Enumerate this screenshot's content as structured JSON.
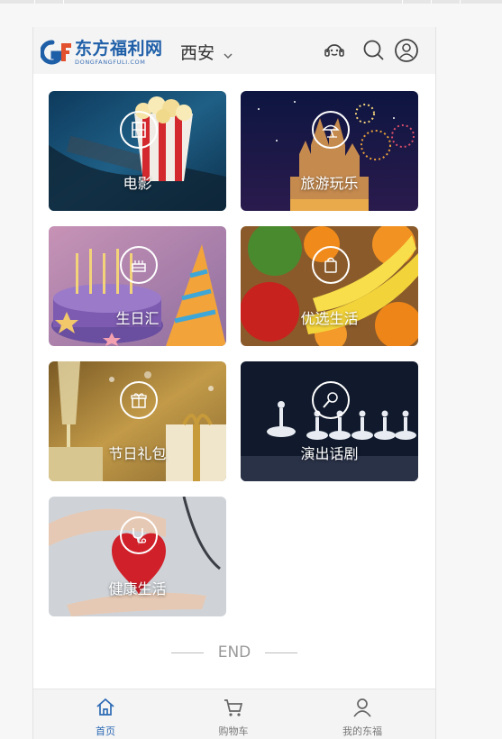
{
  "header": {
    "logo_text": "东方福利网",
    "logo_subtext": "DONGFANGFULI.COM",
    "city": "西安"
  },
  "categories": [
    {
      "label": "电影",
      "icon": "film-icon"
    },
    {
      "label": "旅游玩乐",
      "icon": "beach-umbrella-icon"
    },
    {
      "label": "生日汇",
      "icon": "cake-icon"
    },
    {
      "label": "优选生活",
      "icon": "shopping-bag-icon"
    },
    {
      "label": "节日礼包",
      "icon": "gift-icon"
    },
    {
      "label": "演出话剧",
      "icon": "microphone-icon"
    },
    {
      "label": "健康生活",
      "icon": "stethoscope-icon"
    }
  ],
  "footer": {
    "end_text": "END"
  },
  "tabbar": {
    "items": [
      {
        "label": "首页",
        "icon": "home-icon",
        "active": true
      },
      {
        "label": "购物车",
        "icon": "cart-icon",
        "active": false
      },
      {
        "label": "我的东福",
        "icon": "user-icon",
        "active": false
      }
    ]
  },
  "colors": {
    "brand": "#1f5fa8",
    "active_tab": "#2e6bb5",
    "text": "#333333"
  }
}
